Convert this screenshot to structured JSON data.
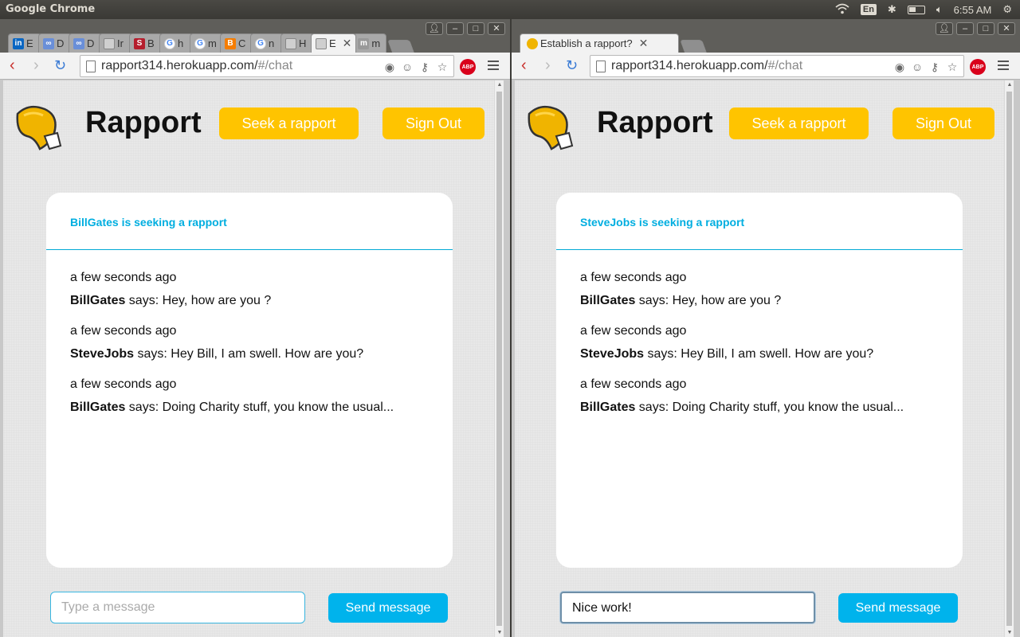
{
  "system": {
    "app_name": "Google Chrome",
    "lang": "En",
    "clock": "6:55 AM"
  },
  "left": {
    "tabs": [
      {
        "label": "E",
        "icon": "linkedin-icon",
        "color": "#0a66c2",
        "glyph": "in"
      },
      {
        "label": "D",
        "icon": "chain-icon",
        "color": "#6a8fd8",
        "glyph": "∞"
      },
      {
        "label": "D",
        "icon": "chain-icon",
        "color": "#6a8fd8",
        "glyph": "∞"
      },
      {
        "label": "Ir",
        "icon": "page-icon",
        "color": "#cfcfcf",
        "glyph": ""
      },
      {
        "label": "B",
        "icon": "s-icon",
        "color": "#b51e2d",
        "glyph": "S"
      },
      {
        "label": "h",
        "icon": "google-icon",
        "color": "#ffffff",
        "glyph": "G"
      },
      {
        "label": "m",
        "icon": "google-icon",
        "color": "#ffffff",
        "glyph": "G"
      },
      {
        "label": "C",
        "icon": "blogger-icon",
        "color": "#f57d00",
        "glyph": "B"
      },
      {
        "label": "n",
        "icon": "google-icon",
        "color": "#ffffff",
        "glyph": "G"
      },
      {
        "label": "H",
        "icon": "page-icon",
        "color": "#cfcfcf",
        "glyph": ""
      },
      {
        "label": "E",
        "icon": "page-icon",
        "color": "#cfcfcf",
        "glyph": "",
        "active": true
      },
      {
        "label": "m",
        "icon": "m-icon",
        "color": "#999999",
        "glyph": "m"
      }
    ],
    "url_host": "rapport314.herokuapp.com/",
    "url_path": "#/chat",
    "brand": "Rapport",
    "seek_label": "Seek a rapport",
    "signout_label": "Sign Out",
    "chat_header": "BillGates is seeking a rapport",
    "messages": [
      {
        "time": "a few seconds ago",
        "author": "BillGates",
        "text": " says: Hey, how are you ?"
      },
      {
        "time": "a few seconds ago",
        "author": "SteveJobs",
        "text": " says: Hey Bill, I am swell. How are you?"
      },
      {
        "time": "a few seconds ago",
        "author": "BillGates",
        "text": " says: Doing Charity stuff, you know the usual..."
      }
    ],
    "input_placeholder": "Type a message",
    "input_value": "",
    "send_label": "Send message"
  },
  "right": {
    "tab_title": "Establish a rapport?",
    "url_host": "rapport314.herokuapp.com/",
    "url_path": "#/chat",
    "brand": "Rapport",
    "seek_label": "Seek a rapport",
    "signout_label": "Sign Out",
    "chat_header": "SteveJobs is seeking a rapport",
    "messages": [
      {
        "time": "a few seconds ago",
        "author": "BillGates",
        "text": " says: Hey, how are you ?"
      },
      {
        "time": "a few seconds ago",
        "author": "SteveJobs",
        "text": " says: Hey Bill, I am swell. How are you?"
      },
      {
        "time": "a few seconds ago",
        "author": "BillGates",
        "text": " says: Doing Charity stuff, you know the usual..."
      }
    ],
    "input_value": "Nice work!",
    "send_label": "Send message"
  },
  "colors": {
    "accent_yellow": "#ffc400",
    "accent_blue": "#00b3ec",
    "header_text": "#00aee0"
  }
}
